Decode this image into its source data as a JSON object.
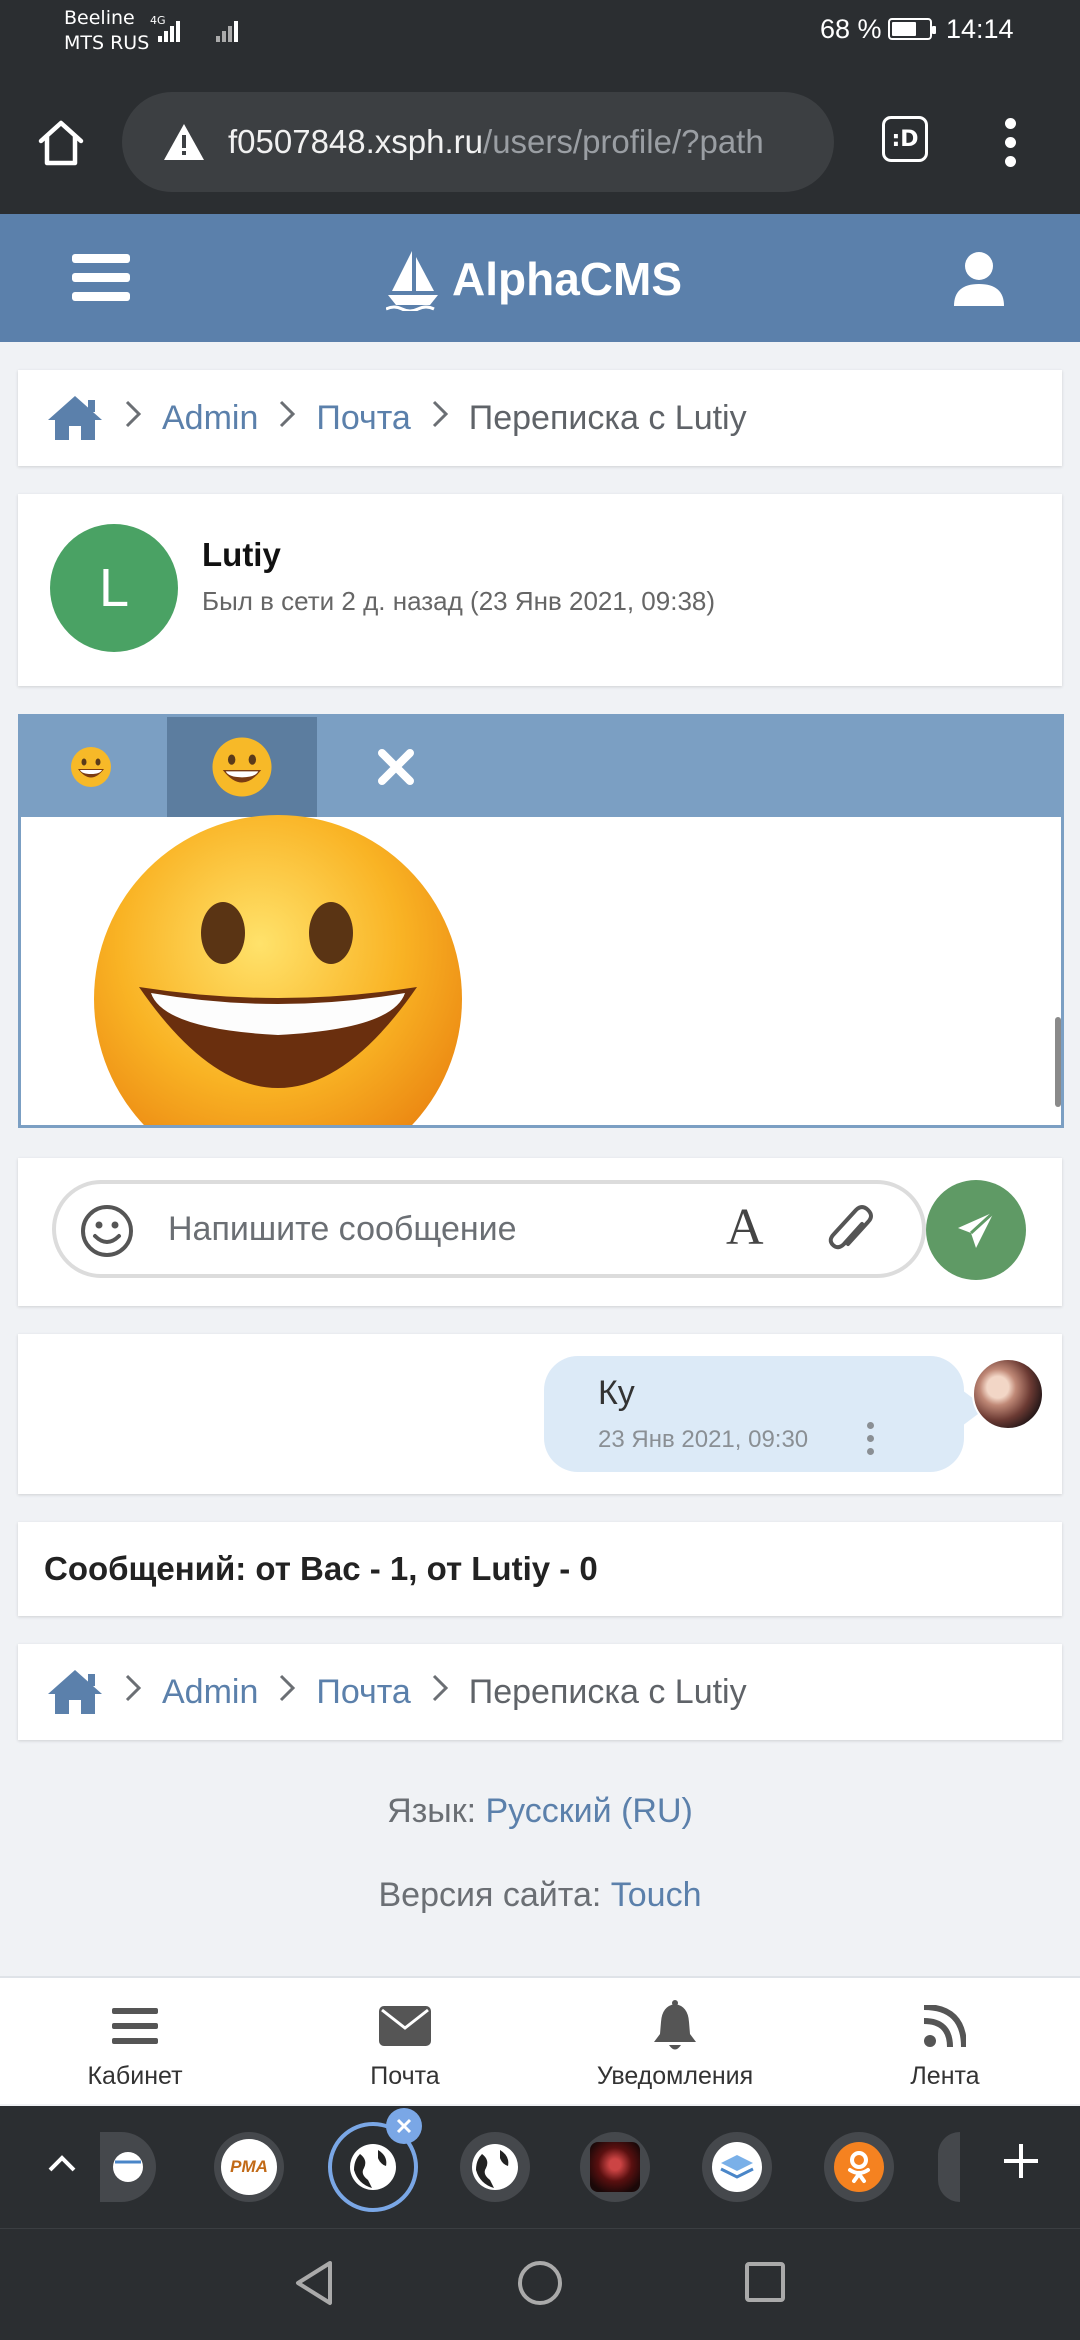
{
  "status_bar": {
    "carrier1": "Beeline",
    "carrier2": "MTS RUS",
    "net_type": "4G",
    "battery": "68 %",
    "battery_level": 0.68,
    "time": "14:14"
  },
  "browser": {
    "url_host": "f0507848.xsph.ru",
    "url_path": "/users/profile/?path",
    "tabs_label": ":D"
  },
  "header": {
    "site_name": "AlphaCMS"
  },
  "breadcrumb": {
    "items": [
      "Admin",
      "Почта"
    ],
    "current": "Переписка с Lutiy"
  },
  "contact": {
    "initial": "L",
    "name": "Lutiy",
    "status": "Был в сети 2 д. назад (23 Янв 2021, 09:38)"
  },
  "compose": {
    "placeholder": "Напишите сообщение",
    "format_glyph": "A"
  },
  "message": {
    "text": "Ку",
    "time": "23 Янв 2021, 09:30"
  },
  "stats": {
    "text": "Сообщений: от Вас - 1, от Lutiy - 0"
  },
  "footer": {
    "lang_label": "Язык:",
    "lang_value": "Русский (RU)",
    "version_label": "Версия сайта:",
    "version_value": "Touch"
  },
  "bottom_nav": {
    "items": [
      "Кабинет",
      "Почта",
      "Уведомления",
      "Лента"
    ]
  },
  "tab_strip": {
    "pma_label": "PMA"
  },
  "colors": {
    "brand": "#5b80ab",
    "smile_panel": "#7b9fc3",
    "send": "#5f9a65",
    "avatar": "#4aa264",
    "bubble": "#dceaf7"
  }
}
